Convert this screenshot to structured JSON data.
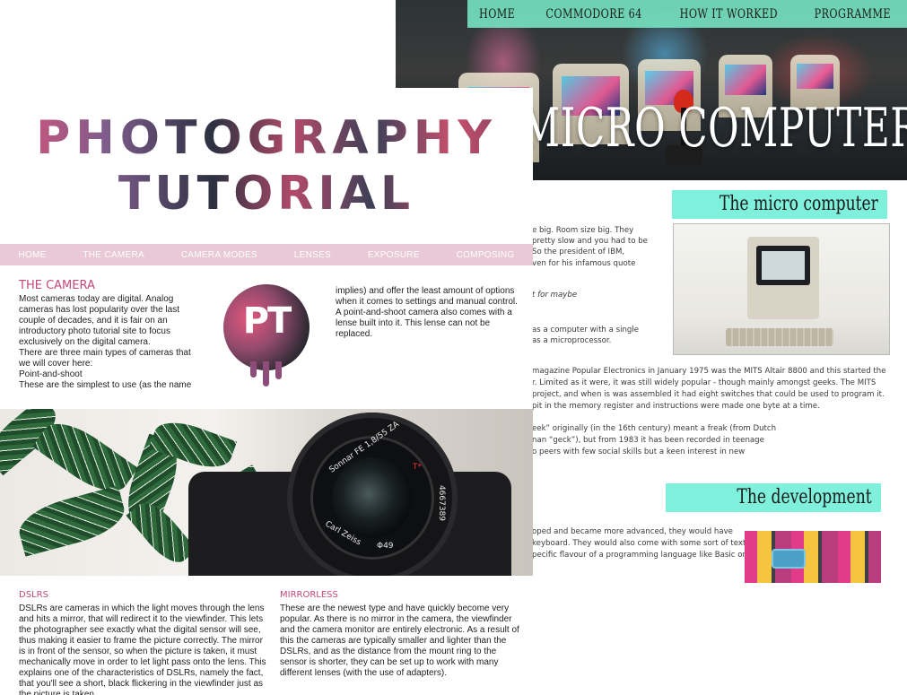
{
  "back_page": {
    "nav": [
      "HOME",
      "COMMODORE 64",
      "HOW IT WORKED",
      "PROGRAMME"
    ],
    "hero_title": "MICRO COMPUTER",
    "section1_heading": "The micro computer",
    "section1_lines": [
      "e big. Room size big. They",
      "pretty slow and you had to be",
      "So the president of IBM,",
      "ven for his infamous quote"
    ],
    "section1_italic": "t for maybe",
    "section1_lines2": [
      "as a computer with a single",
      "as a microprocessor."
    ],
    "section1_para": [
      "magazine Popular Electronics in January 1975 was the MITS Altair 8800 and this started the",
      "r. Limited as it were, it was still widely popular - though mainly amongst geeks. The MITS",
      "project, and when is was assembled it had eight switches that could be used to program it.",
      "pit in the memory register and instructions were made one byte at a time."
    ],
    "section1_para2": [
      "eek” originally (in the 16th century) meant a freak (from Dutch",
      "nan “geck”), but from 1983 it has been recorded in teenage",
      "o peers with few social skills but a keen interest in new"
    ],
    "section2_heading": "The development",
    "section2_lines": [
      "oped and became more advanced, they would have",
      "keyboard. They would also come with some sort of text",
      "pecific flavour of a programming language like Basic or"
    ]
  },
  "front_page": {
    "title_line1": "PHOTOGRAPHY",
    "title_line2": "TUTORIAL",
    "nav": [
      "HOME",
      "THE CAMERA",
      "CAMERA MODES",
      "LENSES",
      "EXPOSURE",
      "COMPOSING"
    ],
    "camera_heading": "THE CAMERA",
    "camera_col1": [
      "Most cameras today are digital. Analog cameras has lost popularity over the last couple of decades, and it is fair on an introductory photo tutorial site to focus exclusively on the digital camera.",
      "There are three main types of cameras that we will cover here:",
      "Point-and-shoot",
      "These are the simplest to use (as the name"
    ],
    "camera_col2": "implies) and offer the least amount of options when it comes to settings and manual control. A point-and-shoot camera also comes with a lense built into it. This lense can not be replaced.",
    "logo_text": "PT",
    "lens_text_top": "Sonnar FE 1,8/55 ZA",
    "lens_text_side": "4667389",
    "lens_text_bottom": "Carl Zeiss",
    "lens_text_phi": "Φ49",
    "lens_text_t": "T*",
    "dslr_heading": "DSLRS",
    "dslr_text": "DSLRs are cameras in which the light moves through the lens and hits a mirror, that will redirect it to the viewfinder. This lets the photographer see exactly what the digital sensor will see, thus making it easier to frame the picture correctly. The mirror is in front of the sensor, so when the picture is taken, it must mechanically move in order to let light pass onto the lens. This explains one of the characteristics of DSLRs, namely the fact, that you'll see a short, black flickering in the viewfinder just as the picture is taken.",
    "mirrorless_heading": "MIRRORLESS",
    "mirrorless_text": "These are the newest type and have quickly become very popular. As there is no mirror in the camera, the viewfinder and the camera monitor are entirely electronic. As a result of this the cameras are typically smaller and lighter than the DSLRs, and as the distance from the mount ring to the sensor is shorter, they can be set up to work with many different lenses (with the use of adapters)."
  },
  "colors": {
    "mint": "#7ef0dc",
    "pink_accent": "#c2497a",
    "pink_nav": "#e9c9d5"
  }
}
